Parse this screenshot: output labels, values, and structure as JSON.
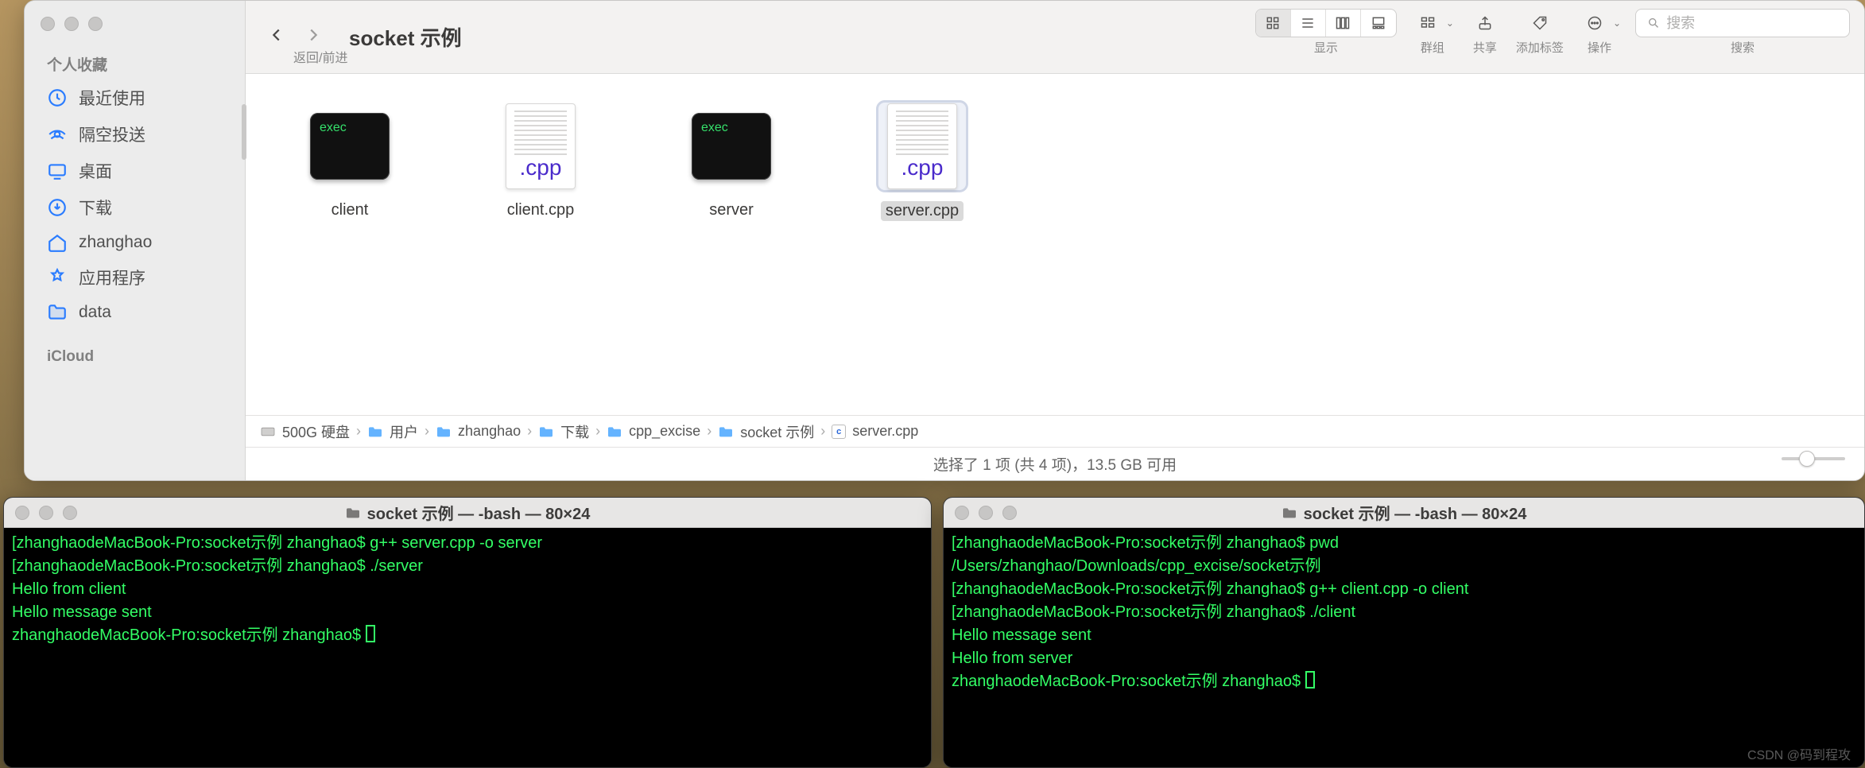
{
  "finder": {
    "title": "socket 示例",
    "nav_caption": "返回/前进",
    "sidebar": {
      "favorites_label": "个人收藏",
      "items": [
        {
          "icon": "clock",
          "label": "最近使用"
        },
        {
          "icon": "airdrop",
          "label": "隔空投送"
        },
        {
          "icon": "desktop",
          "label": "桌面"
        },
        {
          "icon": "download",
          "label": "下载"
        },
        {
          "icon": "home",
          "label": "zhanghao"
        },
        {
          "icon": "apps",
          "label": "应用程序"
        },
        {
          "icon": "folder",
          "label": "data"
        }
      ],
      "icloud_label": "iCloud"
    },
    "toolbar": {
      "group_display": "显示",
      "group_groups": "群组",
      "group_share": "共享",
      "group_tags": "添加标签",
      "group_actions": "操作",
      "group_search": "搜索",
      "search_placeholder": "搜索"
    },
    "files": [
      {
        "name": "client",
        "type": "exec",
        "selected": false,
        "label": "exec"
      },
      {
        "name": "client.cpp",
        "type": "cpp",
        "selected": false,
        "ext": ".cpp"
      },
      {
        "name": "server",
        "type": "exec",
        "selected": false,
        "label": "exec"
      },
      {
        "name": "server.cpp",
        "type": "cpp",
        "selected": true,
        "ext": ".cpp"
      }
    ],
    "path": [
      {
        "icon": "disk",
        "label": "500G 硬盘"
      },
      {
        "icon": "folder",
        "label": "用户"
      },
      {
        "icon": "folder",
        "label": "zhanghao"
      },
      {
        "icon": "folder",
        "label": "下载"
      },
      {
        "icon": "folder",
        "label": "cpp_excise"
      },
      {
        "icon": "folder",
        "label": "socket 示例"
      },
      {
        "icon": "cfile",
        "label": "server.cpp"
      }
    ],
    "status": "选择了 1 项 (共 4 项)，13.5 GB 可用"
  },
  "terminals": {
    "left": {
      "title": "socket 示例 — -bash — 80×24",
      "lines": [
        "[zhanghaodeMacBook-Pro:socket示例 zhanghao$ g++ server.cpp -o server",
        "[zhanghaodeMacBook-Pro:socket示例 zhanghao$ ./server",
        "Hello from client",
        "Hello message sent",
        "zhanghaodeMacBook-Pro:socket示例 zhanghao$ "
      ]
    },
    "right": {
      "title": "socket 示例 — -bash — 80×24",
      "lines": [
        "[zhanghaodeMacBook-Pro:socket示例 zhanghao$ pwd",
        "/Users/zhanghao/Downloads/cpp_excise/socket示例",
        "[zhanghaodeMacBook-Pro:socket示例 zhanghao$ g++ client.cpp -o client",
        "[zhanghaodeMacBook-Pro:socket示例 zhanghao$ ./client",
        "Hello message sent",
        "Hello from server",
        "zhanghaodeMacBook-Pro:socket示例 zhanghao$ "
      ]
    }
  },
  "watermark": "CSDN @码到程攻"
}
